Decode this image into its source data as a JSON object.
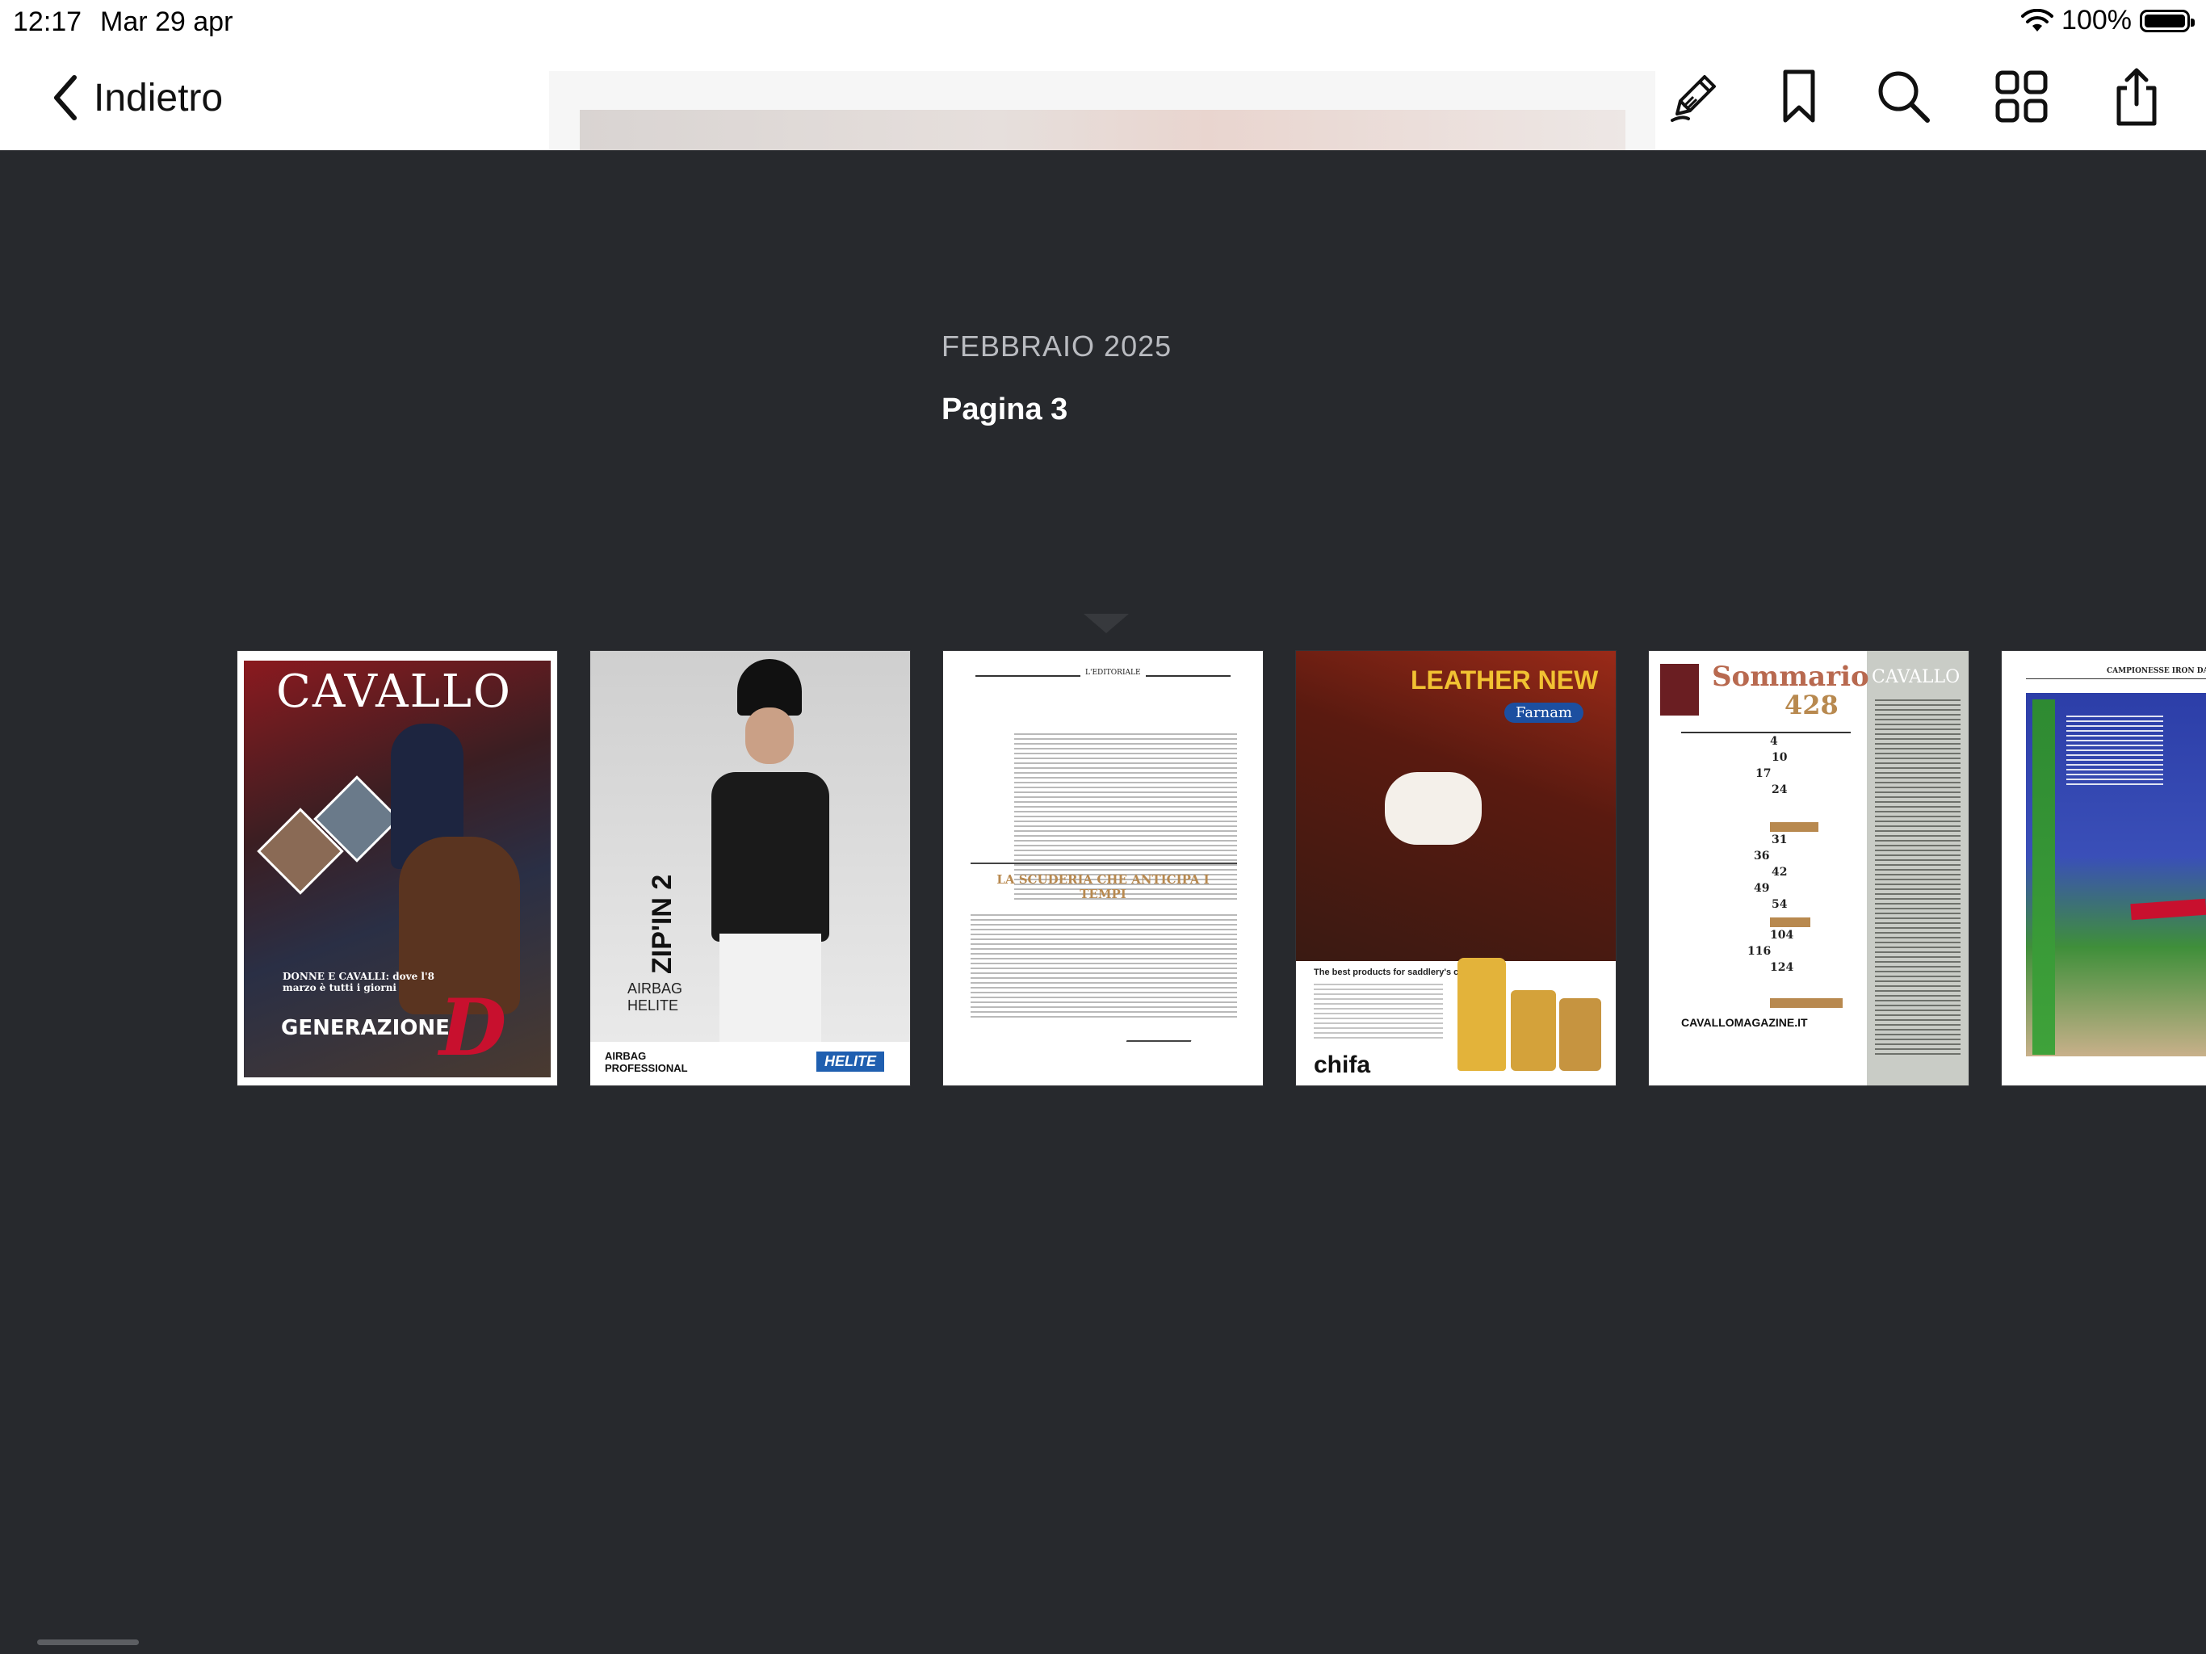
{
  "status_bar": {
    "time": "12:17",
    "date": "Mar 29 apr",
    "battery": "100%"
  },
  "nav": {
    "back_label": "Indietro"
  },
  "toolbar": {
    "icons": [
      "annotate-pen-icon",
      "bookmark-icon",
      "search-icon",
      "grid-view-icon",
      "share-icon"
    ]
  },
  "info": {
    "issue": "FEBBRAIO 2025",
    "page": "Pagina 3"
  },
  "thumbnails": [
    {
      "masthead": "CAVALLO",
      "cover_line": "DONNE E CAVALLI: dove l'8 marzo è tutti i giorni",
      "cover_title": "GENERAZIONE",
      "cover_big_letter": "D"
    },
    {
      "product": "ZIP'IN 2",
      "brand": "AIRBAG HELITE",
      "footer_left": "AIRBAG PROFESSIONAL",
      "footer_right": "HELITE"
    },
    {
      "section": "L'EDITORIALE",
      "headline": "LA SCUDERIA CHE ANTICIPA I TEMPI"
    },
    {
      "headline": "LEATHER NEW",
      "brand": "Farnam",
      "tagline": "The best products for saddlery's care",
      "distributor": "chifa"
    },
    {
      "title": "Sommario",
      "number": "428",
      "masthead": "CAVALLO",
      "site": "CAVALLOMAGAZINE.IT",
      "toc_numbers": [
        "4",
        "10",
        "17",
        "24",
        "31",
        "36",
        "42",
        "49",
        "54",
        "104",
        "116",
        "124"
      ]
    },
    {
      "header": "CAMPIONESSE IRON DAMES"
    }
  ],
  "colors": {
    "background": "#27292d",
    "bar": "#ffffff",
    "cover_red": "#c8102e",
    "accent_gold": "#b8894f"
  }
}
